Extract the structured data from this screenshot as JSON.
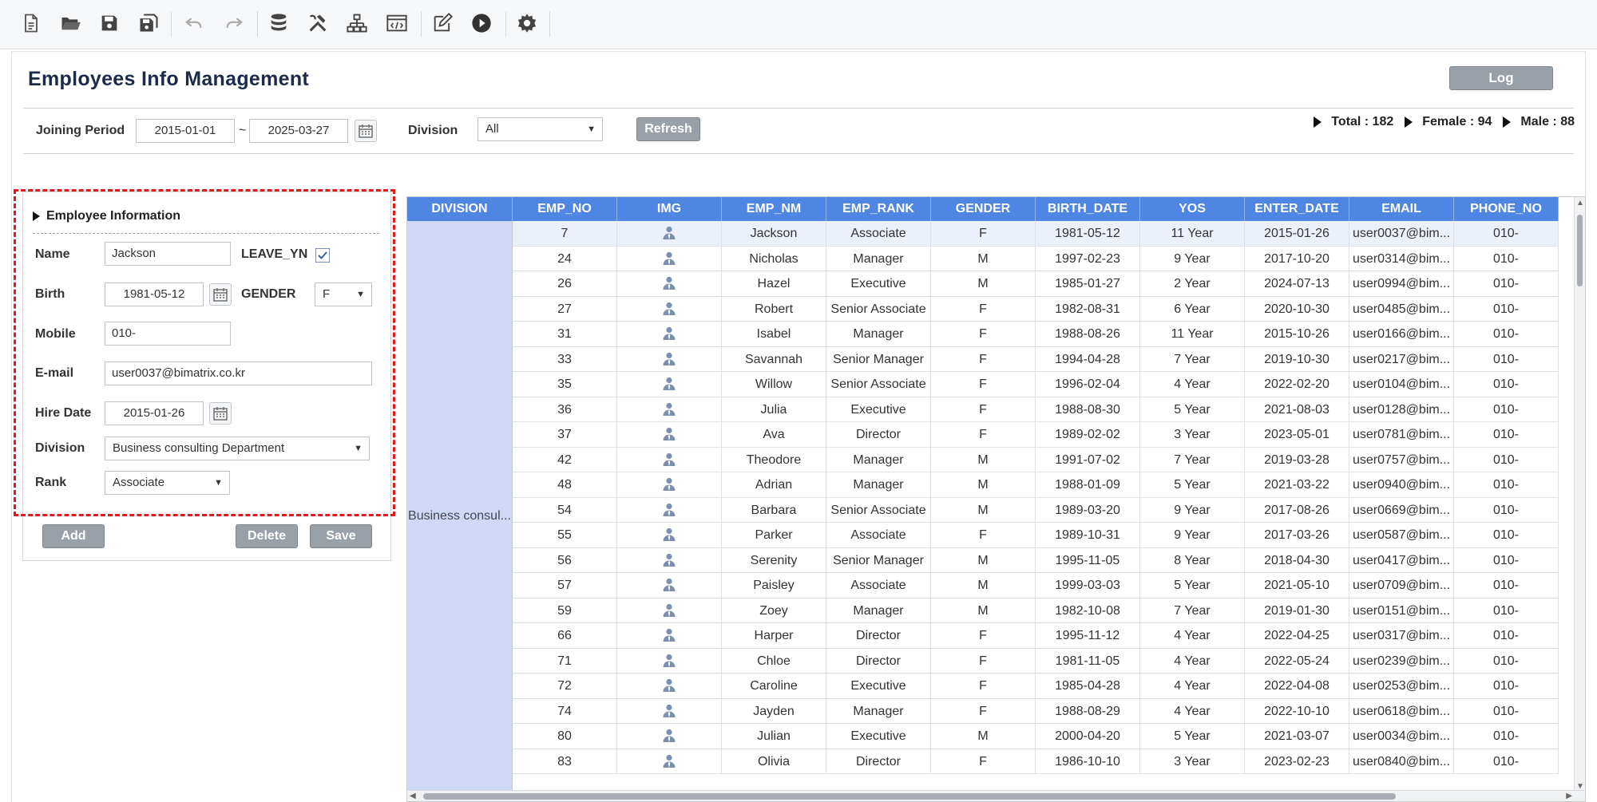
{
  "toolbar": {
    "icons": [
      "new-file-icon",
      "open-folder-icon",
      "save-icon",
      "save-all-icon",
      "undo-icon",
      "redo-icon",
      "database-icon",
      "tools-icon",
      "hierarchy-icon",
      "code-window-icon",
      "edit-icon",
      "run-icon",
      "settings-icon"
    ]
  },
  "page": {
    "title": "Employees Info Management",
    "log_label": "Log"
  },
  "filter": {
    "joining_period_label": "Joining Period",
    "date_from": "2015-01-01",
    "tilde": "~",
    "date_to": "2025-03-27",
    "division_label": "Division",
    "division_value": "All",
    "refresh_label": "Refresh"
  },
  "summary": {
    "total": "Total : 182",
    "female": "Female : 94",
    "male": "Male : 88"
  },
  "form": {
    "section_title": "Employee Information",
    "name_label": "Name",
    "name_value": "Jackson",
    "leave_label": "LEAVE_YN",
    "leave_checked": true,
    "birth_label": "Birth",
    "birth_value": "1981-05-12",
    "gender_label": "GENDER",
    "gender_value": "F",
    "mobile_label": "Mobile",
    "mobile_value": "010-",
    "email_label": "E-mail",
    "email_value": "user0037@bimatrix.co.kr",
    "hire_label": "Hire Date",
    "hire_value": "2015-01-26",
    "division_label": "Division",
    "division_value": "Business consulting Department",
    "rank_label": "Rank",
    "rank_value": "Associate",
    "add_label": "Add",
    "delete_label": "Delete",
    "save_label": "Save"
  },
  "grid": {
    "columns": [
      "DIVISION",
      "EMP_NO",
      "IMG",
      "EMP_NM",
      "EMP_RANK",
      "GENDER",
      "BIRTH_DATE",
      "YOS",
      "ENTER_DATE",
      "EMAIL",
      "PHONE_NO"
    ],
    "division_value": "Business consul...",
    "rows": [
      [
        "7",
        "Jackson",
        "Associate",
        "F",
        "1981-05-12",
        "11 Year",
        "2015-01-26",
        "user0037@bim...",
        "010-"
      ],
      [
        "24",
        "Nicholas",
        "Manager",
        "M",
        "1997-02-23",
        "9 Year",
        "2017-10-20",
        "user0314@bim...",
        "010-"
      ],
      [
        "26",
        "Hazel",
        "Executive",
        "M",
        "1985-01-27",
        "2 Year",
        "2024-07-13",
        "user0994@bim...",
        "010-"
      ],
      [
        "27",
        "Robert",
        "Senior Associate",
        "F",
        "1982-08-31",
        "6 Year",
        "2020-10-30",
        "user0485@bim...",
        "010-"
      ],
      [
        "31",
        "Isabel",
        "Manager",
        "F",
        "1988-08-26",
        "11 Year",
        "2015-10-26",
        "user0166@bim...",
        "010-"
      ],
      [
        "33",
        "Savannah",
        "Senior Manager",
        "F",
        "1994-04-28",
        "7 Year",
        "2019-10-30",
        "user0217@bim...",
        "010-"
      ],
      [
        "35",
        "Willow",
        "Senior Associate",
        "F",
        "1996-02-04",
        "4 Year",
        "2022-02-20",
        "user0104@bim...",
        "010-"
      ],
      [
        "36",
        "Julia",
        "Executive",
        "F",
        "1988-08-30",
        "5 Year",
        "2021-08-03",
        "user0128@bim...",
        "010-"
      ],
      [
        "37",
        "Ava",
        "Director",
        "F",
        "1989-02-02",
        "3 Year",
        "2023-05-01",
        "user0781@bim...",
        "010-"
      ],
      [
        "42",
        "Theodore",
        "Manager",
        "M",
        "1991-07-02",
        "7 Year",
        "2019-03-28",
        "user0757@bim...",
        "010-"
      ],
      [
        "48",
        "Adrian",
        "Manager",
        "M",
        "1988-01-09",
        "5 Year",
        "2021-03-22",
        "user0940@bim...",
        "010-"
      ],
      [
        "54",
        "Barbara",
        "Senior Associate",
        "M",
        "1989-03-20",
        "9 Year",
        "2017-08-26",
        "user0669@bim...",
        "010-"
      ],
      [
        "55",
        "Parker",
        "Associate",
        "F",
        "1989-10-31",
        "9 Year",
        "2017-03-26",
        "user0587@bim...",
        "010-"
      ],
      [
        "56",
        "Serenity",
        "Senior Manager",
        "M",
        "1995-11-05",
        "8 Year",
        "2018-04-30",
        "user0417@bim...",
        "010-"
      ],
      [
        "57",
        "Paisley",
        "Associate",
        "M",
        "1999-03-03",
        "5 Year",
        "2021-05-10",
        "user0709@bim...",
        "010-"
      ],
      [
        "59",
        "Zoey",
        "Manager",
        "M",
        "1982-10-08",
        "7 Year",
        "2019-01-30",
        "user0151@bim...",
        "010-"
      ],
      [
        "66",
        "Harper",
        "Director",
        "F",
        "1995-11-12",
        "4 Year",
        "2022-04-25",
        "user0317@bim...",
        "010-"
      ],
      [
        "71",
        "Chloe",
        "Director",
        "F",
        "1981-11-05",
        "4 Year",
        "2022-05-24",
        "user0239@bim...",
        "010-"
      ],
      [
        "72",
        "Caroline",
        "Executive",
        "F",
        "1985-04-28",
        "4 Year",
        "2022-04-08",
        "user0253@bim...",
        "010-"
      ],
      [
        "74",
        "Jayden",
        "Manager",
        "F",
        "1988-08-29",
        "4 Year",
        "2022-10-10",
        "user0618@bim...",
        "010-"
      ],
      [
        "80",
        "Julian",
        "Executive",
        "M",
        "2000-04-20",
        "5 Year",
        "2021-03-07",
        "user0034@bim...",
        "010-"
      ],
      [
        "83",
        "Olivia",
        "Director",
        "F",
        "1986-10-10",
        "3 Year",
        "2023-02-23",
        "user0840@bim...",
        "010-"
      ]
    ]
  }
}
